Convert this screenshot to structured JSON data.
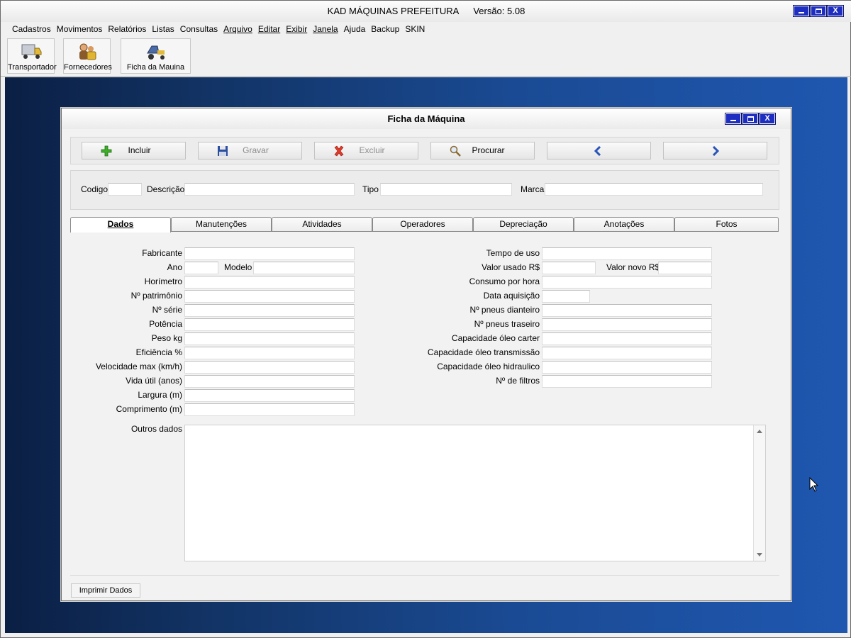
{
  "app": {
    "title": "KAD MÁQUINAS PREFEITURA",
    "version": "Versão: 5.08",
    "close_glyph": "X"
  },
  "menu": [
    "Cadastros",
    "Movimentos",
    "Relatórios",
    "Listas",
    "Consultas",
    "Arquivo",
    "Editar",
    "Exibir",
    "Janela",
    "Ajuda",
    "Backup",
    "SKIN"
  ],
  "toolbar": {
    "transportador": "Transportador",
    "fornecedores": "Fornecedores",
    "ficha": "Ficha da Mauina"
  },
  "child": {
    "title": "Ficha da Máquina",
    "close_glyph": "X"
  },
  "actions": {
    "incluir": "Incluir",
    "gravar": "Gravar",
    "excluir": "Excluir",
    "procurar": "Procurar"
  },
  "header_fields": {
    "codigo": "Codigo",
    "descricao": "Descrição",
    "tipo": "Tipo",
    "marca": "Marca"
  },
  "tabs": [
    "Dados",
    "Manutenções",
    "Atividades",
    "Operadores",
    "Depreciação",
    "Anotações",
    "Fotos"
  ],
  "left_fields": {
    "fabricante": "Fabricante",
    "ano": "Ano",
    "modelo": "Modelo",
    "horimetro": "Horímetro",
    "patrimonio": "Nº patrimônio",
    "serie": "Nº série",
    "potencia": "Potência",
    "peso": "Peso kg",
    "eficiencia": "Eficiência %",
    "velocidade": "Velocidade max (km/h)",
    "vida_util": "Vida útil (anos)",
    "largura": "Largura (m)",
    "comprimento": "Comprimento (m)"
  },
  "right_fields": {
    "tempo_uso": "Tempo de uso",
    "valor_usado": "Valor usado R$",
    "valor_novo": "Valor novo R$",
    "consumo": "Consumo por hora",
    "data_aquisicao": "Data aquisição",
    "pneus_dianteiro": "Nº pneus dianteiro",
    "pneus_traseiro": "Nº pneus traseiro",
    "oleo_carter": "Capacidade óleo carter",
    "oleo_transmissao": "Capacidade óleo transmissão",
    "oleo_hidraulico": "Capacidade óleo hidraulico",
    "filtros": "Nº de filtros"
  },
  "outros_dados": "Outros dados",
  "print_button": "Imprimir Dados",
  "colors": {
    "accent": "#1d2ec0",
    "desktop": "#1a4a93"
  }
}
